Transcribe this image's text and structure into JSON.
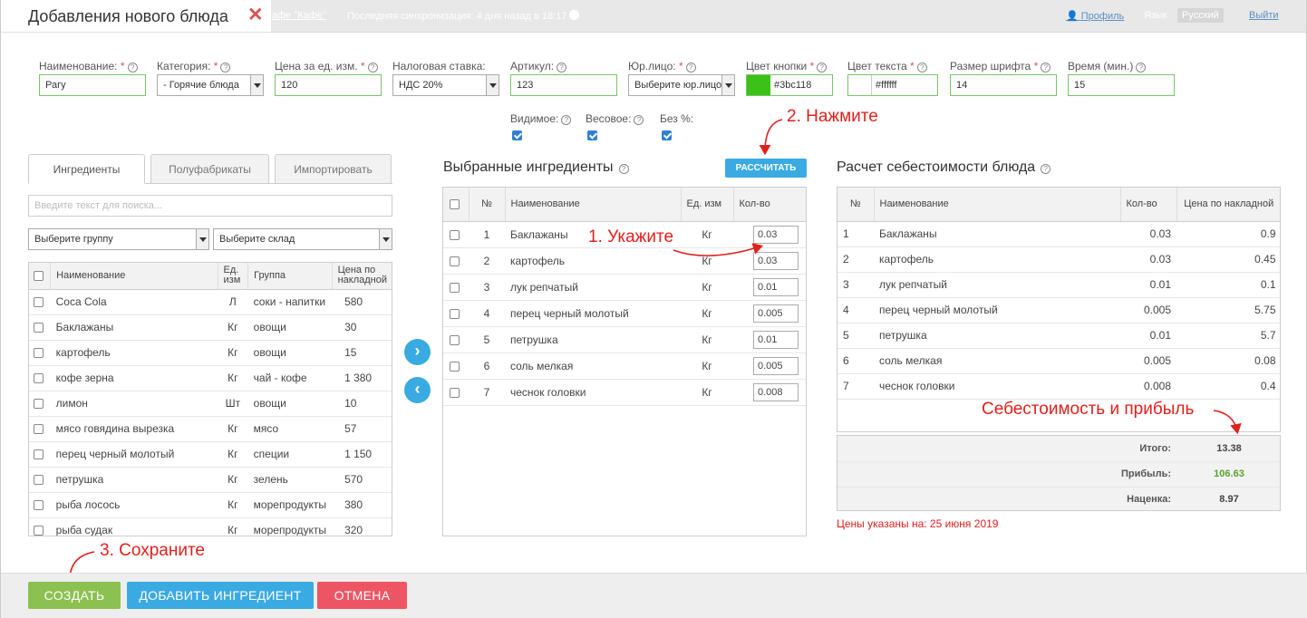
{
  "topbar": {
    "cafe_link": "афе \"Кафе\"",
    "sync_text": "Последняя синхронизация: 4 дня назад в 18:17",
    "profile_label": "Профиль",
    "lang_label": "Язык",
    "lang_value": "Русский",
    "exit_label": "Выйти"
  },
  "dialog": {
    "title": "Добавления нового блюда",
    "close": "✕"
  },
  "form": {
    "name": {
      "label": "Наименование:",
      "req": "*",
      "value": "Рагу"
    },
    "category": {
      "label": "Категория:",
      "req": "*",
      "value": "- Горячие блюда"
    },
    "price": {
      "label": "Цена за ед. изм.",
      "req": "*",
      "value": "120"
    },
    "tax": {
      "label": "Налоговая ставка:",
      "value": "НДС 20%"
    },
    "article": {
      "label": "Артикул:",
      "value": "123"
    },
    "legal": {
      "label": "Юр.лицо:",
      "req": "*",
      "value": "Выберите юр.лицо"
    },
    "btn_color": {
      "label": "Цвет кнопки",
      "req": "*",
      "value": "#3bc118",
      "swatch": "#3bc118"
    },
    "text_color": {
      "label": "Цвет текста",
      "req": "*",
      "value": "#ffffff",
      "swatch": "#ffffff"
    },
    "font_size": {
      "label": "Размер шрифта",
      "req": "*",
      "value": "14"
    },
    "time": {
      "label": "Время (мин.)",
      "value": "15"
    },
    "visible": {
      "label": "Видимое:"
    },
    "weighted": {
      "label": "Весовое:"
    },
    "no_percent": {
      "label": "Без %:"
    }
  },
  "tabs": [
    "Ингредиенты",
    "Полуфабрикаты",
    "Импортировать"
  ],
  "search_placeholder": "Введите текст для поиска...",
  "group_select": "Выберите группу",
  "warehouse_select": "Выберите склад",
  "ingredients": {
    "headers": [
      "Наименование",
      "Ед. изм",
      "Группа",
      "Цена по накладной"
    ],
    "rows": [
      [
        "Coca Cola",
        "Л",
        "соки - напитки",
        "580"
      ],
      [
        "Баклажаны",
        "Кг",
        "овощи",
        "30"
      ],
      [
        "картофель",
        "Кг",
        "овощи",
        "15"
      ],
      [
        "кофе зерна",
        "Кг",
        "чай - кофе",
        "1 380"
      ],
      [
        "лимон",
        "Шт",
        "овощи",
        "10"
      ],
      [
        "мясо говядина вырезка",
        "Кг",
        "мясо",
        "57"
      ],
      [
        "перец черный молотый",
        "Кг",
        "специи",
        "1 150"
      ],
      [
        "петрушка",
        "Кг",
        "зелень",
        "570"
      ],
      [
        "рыба лосось",
        "Кг",
        "морепродукты",
        "380"
      ],
      [
        "рыба судак",
        "Кг",
        "морепродукты",
        "320"
      ]
    ]
  },
  "selected": {
    "title": "Выбранные ингредиенты",
    "calc_button": "РАССЧИТАТЬ",
    "headers": [
      "№",
      "Наименование",
      "Ед. изм",
      "Кол-во"
    ],
    "rows": [
      [
        "1",
        "Баклажаны",
        "Кг",
        "0.03"
      ],
      [
        "2",
        "картофель",
        "Кг",
        "0.03"
      ],
      [
        "3",
        "лук репчатый",
        "Кг",
        "0.01"
      ],
      [
        "4",
        "перец черный молотый",
        "Кг",
        "0.005"
      ],
      [
        "5",
        "петрушка",
        "Кг",
        "0.01"
      ],
      [
        "6",
        "соль мелкая",
        "Кг",
        "0.005"
      ],
      [
        "7",
        "чеснок головки",
        "Кг",
        "0.008"
      ]
    ]
  },
  "cost": {
    "title": "Расчет себестоимости блюда",
    "headers": [
      "№",
      "Наименование",
      "Кол-во",
      "Цена по накладной"
    ],
    "rows": [
      [
        "1",
        "Баклажаны",
        "0.03",
        "0.9"
      ],
      [
        "2",
        "картофель",
        "0.03",
        "0.45"
      ],
      [
        "3",
        "лук репчатый",
        "0.01",
        "0.1"
      ],
      [
        "4",
        "перец черный молотый",
        "0.005",
        "5.75"
      ],
      [
        "5",
        "петрушка",
        "0.01",
        "5.7"
      ],
      [
        "6",
        "соль мелкая",
        "0.005",
        "0.08"
      ],
      [
        "7",
        "чеснок головки",
        "0.008",
        "0.4"
      ]
    ],
    "total_label": "Итого:",
    "total_value": "13.38",
    "profit_label": "Прибыль:",
    "profit_value": "106.63",
    "markup_label": "Наценка:",
    "markup_value": "8.97",
    "prices_date": "Цены указаны на: 25 июня 2019"
  },
  "arrows": {
    "right": "›",
    "left": "‹"
  },
  "annotations": {
    "a1": "1. Укажите",
    "a2": "2. Нажмите",
    "a3": "3. Сохраните",
    "a4": "Себестоимость и прибыль"
  },
  "buttons": {
    "create": "СОЗДАТЬ",
    "add_ingredient": "ДОБАВИТЬ ИНГРЕДИЕНТ",
    "cancel": "ОТМЕНА"
  },
  "colors": {
    "green": "#8cc152",
    "blue": "#3aaae2",
    "red": "#ed5565",
    "annot": "#e0201c"
  }
}
